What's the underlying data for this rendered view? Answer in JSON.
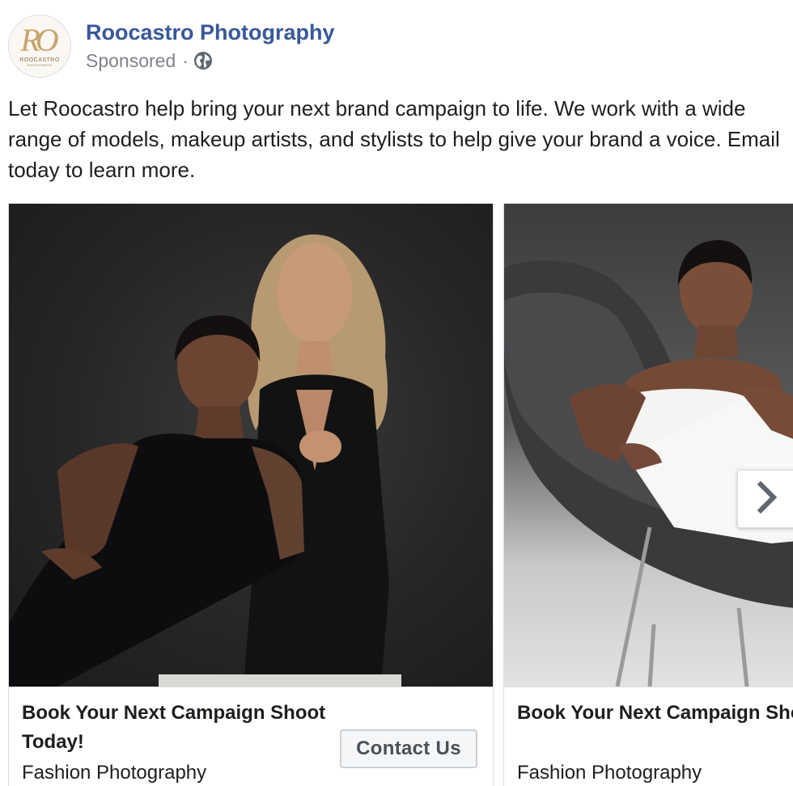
{
  "post": {
    "page_name": "Roocastro Photography",
    "sponsored_label": "Sponsored",
    "separator": "·",
    "privacy_icon": "globe-icon",
    "avatar": {
      "monogram": "RO",
      "wordmark": "ROOCASTRO",
      "tagline": "PHOTOGRAPHY"
    },
    "body_text": "Let Roocastro help bring your next brand campaign to life. We work with a wide range of models, makeup artists, and stylists to help give your brand a voice. Email today to learn more."
  },
  "carousel": {
    "next_icon": "chevron-right-icon",
    "cards": [
      {
        "title": "Book Your Next Campaign Shoot Today!",
        "subtitle": "Fashion Photography",
        "cta_label": "Contact Us"
      },
      {
        "title": "Book Your Next Campaign Shoot Today!",
        "subtitle": "Fashion Photography"
      }
    ]
  },
  "colors": {
    "page_name": "#385898",
    "meta_text": "#7f8389",
    "body_text": "#1c1e21",
    "border": "#dadde1",
    "button_bg": "#f5f6f7",
    "button_text": "#4b4f56"
  }
}
